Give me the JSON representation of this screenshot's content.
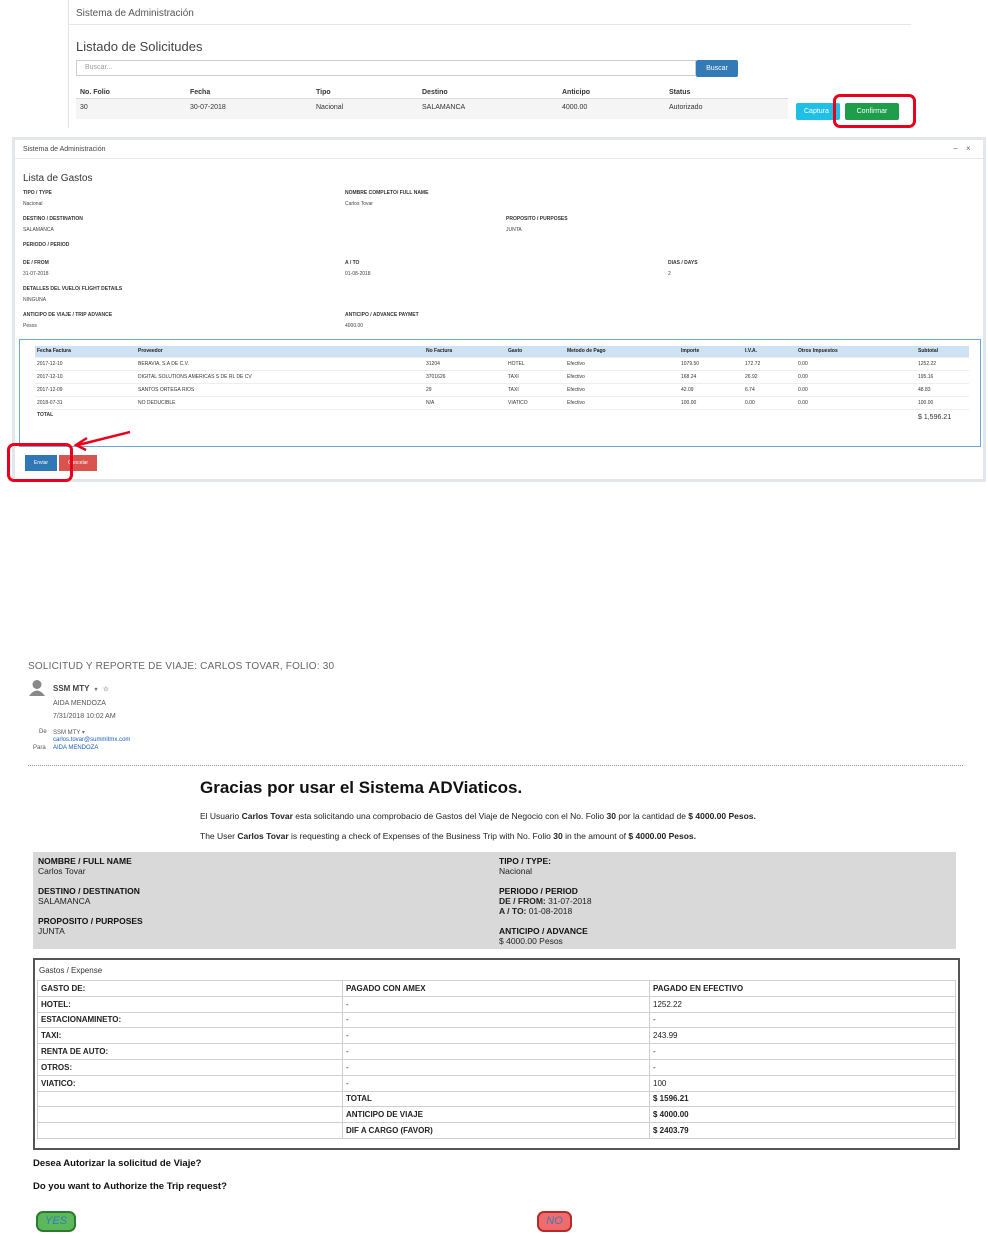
{
  "panel1": {
    "title": "Sistema de Administración",
    "heading": "Listado de Solicitudes",
    "search_placeholder": "Buscar...",
    "search_button": "Buscar",
    "columns": [
      "No. Folio",
      "Fecha",
      "Tipo",
      "Destino",
      "Anticipo",
      "Status"
    ],
    "row": [
      "30",
      "30-07-2018",
      "Nacional",
      "SALAMANCA",
      "4000.00",
      "Autorizado"
    ],
    "captura_button": "Captura",
    "confirm_button": "Confirmar"
  },
  "panel2": {
    "title": "Sistema de Administración",
    "minimize_icon": "−",
    "close_icon": "×",
    "heading": "Lista de Gastos",
    "fields": {
      "tipo_label": "TIPO / TYPE",
      "tipo_value": "Nacional",
      "nombre_label": "NOMBRE COMPLETO/ FULL NAME",
      "nombre_value": "Carlos Tovar",
      "destino_label": "DESTINO / DESTINATION",
      "destino_value": "SALAMANCA",
      "proposito_label": "PROPOSITO / PURPOSES",
      "proposito_value": "JUNTA",
      "periodo_label": "PERIODO / PERIOD",
      "de_label": "DE / FROM",
      "de_value": "31-07-2018",
      "a_label": "A / TO",
      "a_value": "01-08-2018",
      "dias_label": "DIAS / DAYS",
      "dias_value": "2",
      "vuelo_label": "DETALLES DEL VUELO/ FLIGHT DETAILS",
      "vuelo_value": "NINGUNA",
      "anticipo_label": "ANTICIPO DE VIAJE / TRIP ADVANCE",
      "anticipo_value": "Pesos",
      "advance_label": "ANTICIPO / ADVANCE PAYMET",
      "advance_value": "4000.00"
    },
    "columns": [
      "Fecha Factura",
      "Proveedor",
      "No Factura",
      "Gasto",
      "Metodo de Pago",
      "Importe",
      "I.V.A.",
      "Otros Impuestos",
      "Subtotal"
    ],
    "rows": [
      [
        "2017-12-10",
        "BERAVIA, S.A DE C.V.",
        "31204",
        "HOTEL",
        "Efectivo",
        "1079.50",
        "172.72",
        "0.00",
        "1252.22"
      ],
      [
        "2017-12-10",
        "DIGITAL SOLUTIONS AMERICAS S DE RL DE CV",
        "3701626",
        "TAXI",
        "Efectivo",
        "168.24",
        "26.92",
        "0.00",
        "195.16"
      ],
      [
        "2017-12-09",
        "SANTOS ORTEGA RIOS",
        "29",
        "TAXI",
        "Efectivo",
        "42.09",
        "6.74",
        "0.00",
        "48.83"
      ],
      [
        "2018-07-31",
        "NO DEDUCIBLE",
        "N/A",
        "VIATICO",
        "Efectivo",
        "100.00",
        "0.00",
        "0.00",
        "100.00"
      ]
    ],
    "total_label": "TOTAL",
    "total_value": "$ 1,596.21",
    "send_button": "Enviar",
    "cancel_button": "Cancelar"
  },
  "email": {
    "subject": "SOLICITUD Y REPORTE DE VIAJE: CARLOS TOVAR, FOLIO: 30",
    "sender": "SSM MTY",
    "recipient": "AIDA MENDOZA",
    "date": "7/31/2018 10:02 AM",
    "de_label": "De",
    "de_value": "SSM MTY",
    "de_email": "carlos.tovar@summitmx.com",
    "para_label": "Para",
    "para_value": "AIDA MENDOZA",
    "heading": "Gracias por usar el Sistema ADViaticos.",
    "line1": {
      "p1": "El Usuario ",
      "user": "Carlos Tovar",
      "p2": " esta solicitando una comprobacio de Gastos del Viaje de Negocio con el No. Folio ",
      "folio": "30",
      "p3": " por la cantidad de ",
      "amount": "$ 4000.00 Pesos."
    },
    "line2": {
      "p1": "The User ",
      "user": "Carlos Tovar",
      "p2": " is requesting a check of Expenses of the Business Trip with No. Folio ",
      "folio": "30",
      "p3": " in the amount of ",
      "amount": "$ 4000.00 Pesos."
    },
    "info": {
      "nombre_label": "NOMBRE / FULL NAME",
      "nombre_value": "Carlos Tovar",
      "tipo_label": "TIPO / TYPE:",
      "tipo_value": "Nacional",
      "destino_label": "DESTINO / DESTINATION",
      "destino_value": "SALAMANCA",
      "periodo_label": "PERIODO / PERIOD",
      "de_label": "DE / FROM:",
      "de_value": "31-07-2018",
      "a_label": "A / TO:",
      "a_value": "01-08-2018",
      "proposito_label": "PROPOSITO / PURPOSES",
      "proposito_value": "JUNTA",
      "anticipo_label": "ANTICIPO / ADVANCE",
      "anticipo_value": "$ 4000.00 Pesos"
    },
    "expense_caption": "Gastos / Expense",
    "expense_rows": [
      [
        "GASTO DE:",
        "PAGADO CON AMEX",
        "PAGADO EN EFECTIVO"
      ],
      [
        "HOTEL:",
        "-",
        "1252.22"
      ],
      [
        "ESTACIONAMINETO:",
        "-",
        "-"
      ],
      [
        "TAXI:",
        "-",
        "243.99"
      ],
      [
        "RENTA DE AUTO:",
        "-",
        "-"
      ],
      [
        "OTROS:",
        "-",
        "-"
      ],
      [
        "VIATICO:",
        "-",
        "100"
      ],
      [
        "",
        "TOTAL",
        "$ 1596.21"
      ],
      [
        "",
        "ANTICIPO DE VIAJE",
        "$ 4000.00"
      ],
      [
        "",
        "DIF A CARGO (FAVOR)",
        "$ 2403.79"
      ]
    ],
    "question_es": "Desea Autorizar la solicitud de Viaje?",
    "question_en": "Do you want to Authorize the Trip request?",
    "yes": "YES",
    "no": "NO"
  }
}
